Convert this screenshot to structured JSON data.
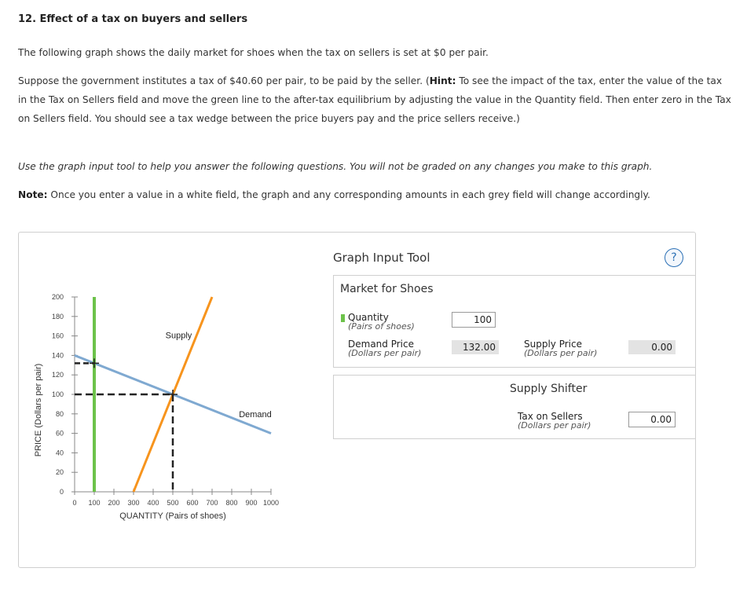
{
  "header": {
    "title": "12. Effect of a tax on buyers and sellers"
  },
  "instructions": {
    "p1": "The following graph shows the daily market for shoes when the tax on sellers is set at $0 per pair.",
    "p2_a": "Suppose the government institutes a tax of $40.60 per pair, to be paid by the seller. (",
    "p2_hint": "Hint:",
    "p2_b": " To see the impact of the tax, enter the value of the tax in the Tax on Sellers field and move the green line to the after-tax equilibrium by adjusting the value in the Quantity field. Then enter zero in the Tax on Sellers field. You should see a tax wedge between the price buyers pay and the price sellers receive.)",
    "p3": "Use the graph input tool to help you answer the following questions. You will not be graded on any changes you make to this graph.",
    "p4_note": "Note:",
    "p4": " Once you enter a value in a white field, the graph and any corresponding amounts in each grey field will change accordingly."
  },
  "graph": {
    "y_axis_label": "PRICE (Dollars per pair)",
    "x_axis_label": "QUANTITY (Pairs of shoes)",
    "supply_label": "Supply",
    "demand_label": "Demand",
    "colors": {
      "supply": "#f7941d",
      "demand": "#7fa9d1",
      "quantity_line": "#6cc24a",
      "dashed": "#222222"
    }
  },
  "chart_data": {
    "type": "line",
    "xlim": [
      0,
      1000
    ],
    "ylim": [
      0,
      200
    ],
    "x_ticks": [
      0,
      100,
      200,
      300,
      400,
      500,
      600,
      700,
      800,
      900,
      1000
    ],
    "y_ticks": [
      0,
      20,
      40,
      60,
      80,
      100,
      120,
      140,
      160,
      180,
      200
    ],
    "series": [
      {
        "name": "Supply",
        "points": [
          [
            300,
            0
          ],
          [
            700,
            200
          ]
        ]
      },
      {
        "name": "Demand",
        "points": [
          [
            0,
            140
          ],
          [
            1000,
            60
          ]
        ]
      }
    ],
    "quantity_line_x": 100,
    "equilibrium": {
      "x": 500,
      "y": 100
    },
    "demand_price_at_quantity": 132.0
  },
  "tool": {
    "title": "Graph Input Tool",
    "help": "?",
    "market_box_title": "Market for Shoes",
    "quantity_label": "Quantity",
    "quantity_unit": "(Pairs of shoes)",
    "quantity_value": "100",
    "demand_price_label": "Demand Price",
    "demand_price_unit": "(Dollars per pair)",
    "demand_price_value": "132.00",
    "supply_price_label": "Supply Price",
    "supply_price_unit": "(Dollars per pair)",
    "supply_price_value": "0.00",
    "shifter_title": "Supply Shifter",
    "tax_label": "Tax on Sellers",
    "tax_unit": "(Dollars per pair)",
    "tax_value": "0.00"
  }
}
